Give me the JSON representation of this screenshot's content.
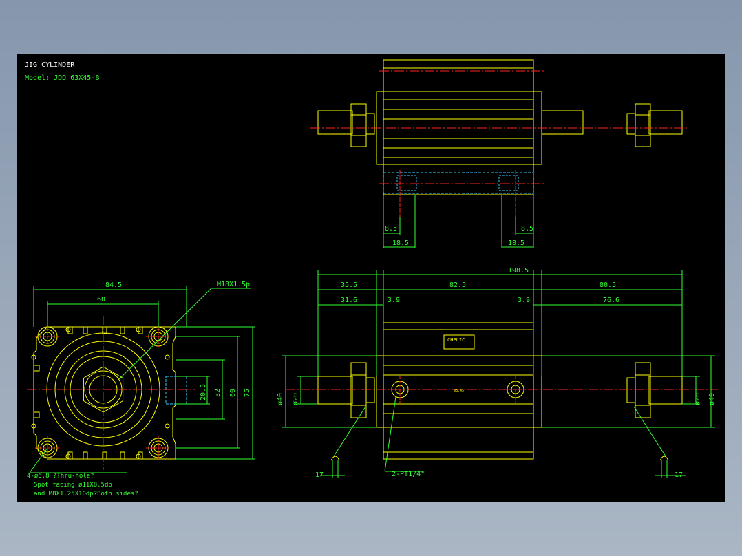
{
  "title": "JIG CYLINDER",
  "model": "Model: JDD 63X45-B",
  "colors": {
    "background": "#000000",
    "outline": "#ffff00",
    "dimension": "#33ff33",
    "centerline": "#ff2222",
    "hidden": "#33ccff",
    "note": "#ffffff"
  },
  "front_view": {
    "dims": {
      "width_outer": "84.5",
      "width_holes": "60",
      "h_20_5": "20.5",
      "h_32": "32",
      "h_60": "60",
      "h_75": "75"
    },
    "thread_callout": "M18X1.5p",
    "notes": [
      "4-ø6.8  ?Thru-hole?",
      "Spot facing  ø11X8.5dp",
      "and M8X1.25X10dp?Both sides?"
    ]
  },
  "top_view": {
    "dims": {
      "left_8_5": "8.5",
      "left_18_5": "18.5",
      "right_8_5": "8.5",
      "right_18_5": "18.5"
    }
  },
  "side_view": {
    "dims": {
      "overall": "198.5",
      "left_35_5": "35.5",
      "mid_82_5": "82.5",
      "right_80_5": "80.5",
      "left_31_6": "31.6",
      "left_3_9": "3.9",
      "right_3_9": "3.9",
      "right_76_6": "76.6",
      "dia_rod_left": "ø20",
      "dia_tol_left": "ø40",
      "dia_rod_right": "ø20",
      "dia_tol_right": "ø40",
      "left_17": "17",
      "right_17": "17"
    },
    "port_callout": "2-PT1/4\"",
    "label_brand": "CHELIC",
    "center_mark": "ø8.45"
  }
}
